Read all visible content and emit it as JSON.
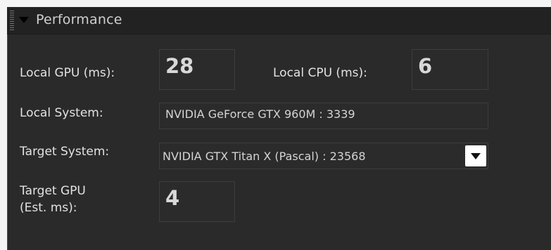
{
  "panel": {
    "title": "Performance",
    "icons": {
      "grip": "grip-handle-icon",
      "collapse": "collapse-triangle-icon",
      "dropdown": "chevron-down-icon"
    }
  },
  "fields": {
    "local_gpu": {
      "label": "Local GPU (ms):",
      "value": "28"
    },
    "local_cpu": {
      "label": "Local CPU (ms):",
      "value": "6"
    },
    "local_system": {
      "label": "Local System:",
      "value": "NVIDIA GeForce GTX 960M : 3339"
    },
    "target_system": {
      "label": "Target System:",
      "value": "NVIDIA GTX Titan X (Pascal) : 23568"
    },
    "target_gpu": {
      "label_line1": "Target GPU",
      "label_line2": "(Est. ms):",
      "value": "4"
    }
  }
}
